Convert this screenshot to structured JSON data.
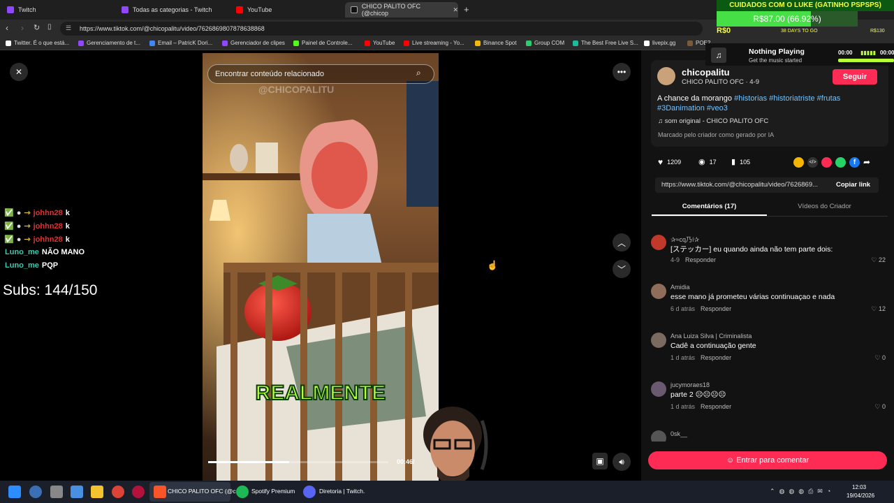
{
  "browser": {
    "tabs": [
      {
        "label": "Twitch",
        "color": "#9146ff"
      },
      {
        "label": "Todas as categorias - Twitch",
        "color": "#9146ff"
      },
      {
        "label": "YouTube",
        "color": "#ff0000"
      },
      {
        "label": "CHICO PALITO OFC (@chicop",
        "color": "#111111"
      }
    ],
    "url": "https://www.tiktok.com/@chicopalitu/video/7626869807878638868",
    "bookmarks": [
      "Twitter. É o que está...",
      "Gerenciamento de t...",
      "Email – PatricK Dori...",
      "Gerenciador de clipes",
      "Painel de Controle...",
      "YouTube",
      "Live streaming - Yo...",
      "Binance Spot",
      "Group COM",
      "The Best Free Live S...",
      "livepix.gg",
      "POE2"
    ]
  },
  "overlay": {
    "goal_title": "CUIDADOS COM O LUKE (GATINHO PSPSPS)",
    "goal_value": "R$87.00 (66.92%)",
    "goal_progress": 0.6692,
    "rs0": "R$0",
    "days": "38 DAYS TO GO",
    "rs130": "R$130",
    "now_playing_title": "Nothing Playing",
    "now_playing_sub": "Get the music started",
    "time_left": "00:00",
    "time_right": "00:00",
    "subs": "Subs: 144/150",
    "chat": [
      {
        "user": "johhn28",
        "msg": "k",
        "color": "#e03030"
      },
      {
        "user": "johhn28",
        "msg": "k",
        "color": "#e03030"
      },
      {
        "user": "johhn28",
        "msg": "k",
        "color": "#e03030"
      },
      {
        "user": "Luno_me",
        "msg": "NÃO MANO",
        "color": "#3ec9b0"
      },
      {
        "user": "Luno_me",
        "msg": "PQP",
        "color": "#3ec9b0"
      }
    ]
  },
  "video": {
    "search_placeholder": "Encontrar conteúdo relacionado",
    "watermark": "@CHICOPALITU",
    "caption": "REALMENTE",
    "time": "00:46/",
    "progress": 0.45
  },
  "post": {
    "username": "chicopalitu",
    "subtitle": "CHICO PALITO OFC · 4-9",
    "follow": "Seguir",
    "desc_text": "A chance da morango ",
    "hashtags_line1": "#historias #historiatriste #frutas",
    "hashtags_line2": "#3Danimation #veo3",
    "sound": "som original - CHICO PALITO OFC",
    "ai_label": "Marcado pelo criador como gerado por IA",
    "likes": "1209",
    "comments": "17",
    "saves": "105",
    "link": "https://www.tiktok.com/@chicopalitu/video/7626869...",
    "copy_link": "Copiar link",
    "tab_comments": "Comentários (17)",
    "tab_videos": "Vídeos do Criador",
    "comment_cta": "Entrar para comentar"
  },
  "comments": [
    {
      "name": "✰≈cq乃í✰",
      "text": "[ステッカー] eu quando ainda não tem parte dois:",
      "date": "4-9",
      "reply": "Responder",
      "likes": "22",
      "avatar": "#c0392b"
    },
    {
      "name": "Amidia",
      "text": "esse mano já prometeu várias continuaçao e nada",
      "date": "6 d atrás",
      "reply": "Responder",
      "likes": "12",
      "avatar": "#8e6e5a"
    },
    {
      "name": "Ana Luiza Silva | Criminalista",
      "text": "Cadê a continuação gente",
      "date": "1 d atrás",
      "reply": "Responder",
      "likes": "0",
      "avatar": "#7a6a60"
    },
    {
      "name": "jucymoraes18",
      "text": "parte 2 ☹☹☹☹",
      "date": "1 d atrás",
      "reply": "Responder",
      "likes": "0",
      "avatar": "#6a5a70"
    },
    {
      "name": "0sk__",
      "text": "",
      "date": "",
      "reply": "",
      "likes": "",
      "avatar": "#555555"
    }
  ],
  "taskbar": {
    "apps": [
      "CHICO PALITO OFC (@c",
      "Spotify Premium",
      "Diretoria | Twitch."
    ],
    "time": "12:03",
    "date": "19/04/2026"
  }
}
